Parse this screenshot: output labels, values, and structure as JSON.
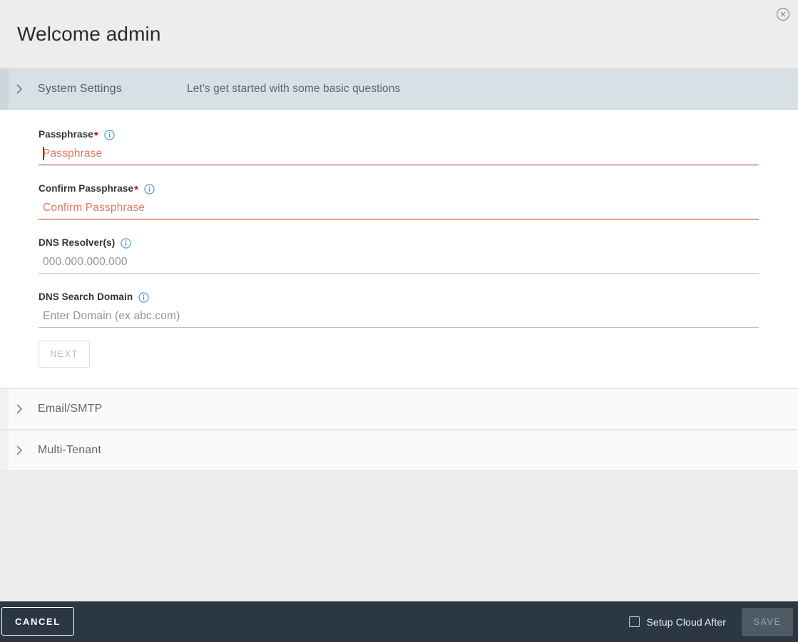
{
  "header": {
    "title": "Welcome admin",
    "close_icon": "close-circle-icon"
  },
  "sections": [
    {
      "id": "system-settings",
      "title": "System Settings",
      "description": "Let's get started with some basic questions",
      "expanded": true,
      "chevron_icon": "chevron-right-icon",
      "fields": [
        {
          "id": "passphrase",
          "label": "Passphrase",
          "required": true,
          "info_icon": "info-circle-icon",
          "value": "",
          "placeholder": "Passphrase",
          "state": "error",
          "focused": true
        },
        {
          "id": "confirm-passphrase",
          "label": "Confirm Passphrase",
          "required": true,
          "info_icon": "info-circle-icon",
          "value": "",
          "placeholder": "Confirm Passphrase",
          "state": "error",
          "focused": false
        },
        {
          "id": "dns-resolvers",
          "label": "DNS Resolver(s)",
          "required": false,
          "info_icon": "info-circle-icon",
          "value": "",
          "placeholder": "000.000.000.000",
          "state": "normal",
          "focused": false
        },
        {
          "id": "dns-search-domain",
          "label": "DNS Search Domain",
          "required": false,
          "info_icon": "info-circle-icon",
          "value": "",
          "placeholder": "Enter Domain (ex abc.com)",
          "state": "normal",
          "focused": false
        }
      ],
      "next_label": "NEXT",
      "next_disabled": true
    },
    {
      "id": "email-smtp",
      "title": "Email/SMTP",
      "description": "",
      "expanded": false,
      "chevron_icon": "chevron-right-icon"
    },
    {
      "id": "multi-tenant",
      "title": "Multi-Tenant",
      "description": "",
      "expanded": false,
      "chevron_icon": "chevron-right-icon"
    }
  ],
  "footer": {
    "cancel_label": "CANCEL",
    "checkbox_label": "Setup Cloud After",
    "checkbox_checked": false,
    "save_label": "SAVE",
    "save_disabled": true
  },
  "colors": {
    "header_bg": "#ededed",
    "expanded_section_bg": "#d7e0e5",
    "collapsed_section_bg": "#fafafa",
    "footer_bg": "#2b3742",
    "error_underline": "#b03312",
    "error_placeholder": "#e5795e",
    "info_icon_blue": "#3d94c8",
    "required_asterisk": "#d0021b",
    "page_bg": "#ededed",
    "save_disabled_bg": "#4e5a64"
  }
}
